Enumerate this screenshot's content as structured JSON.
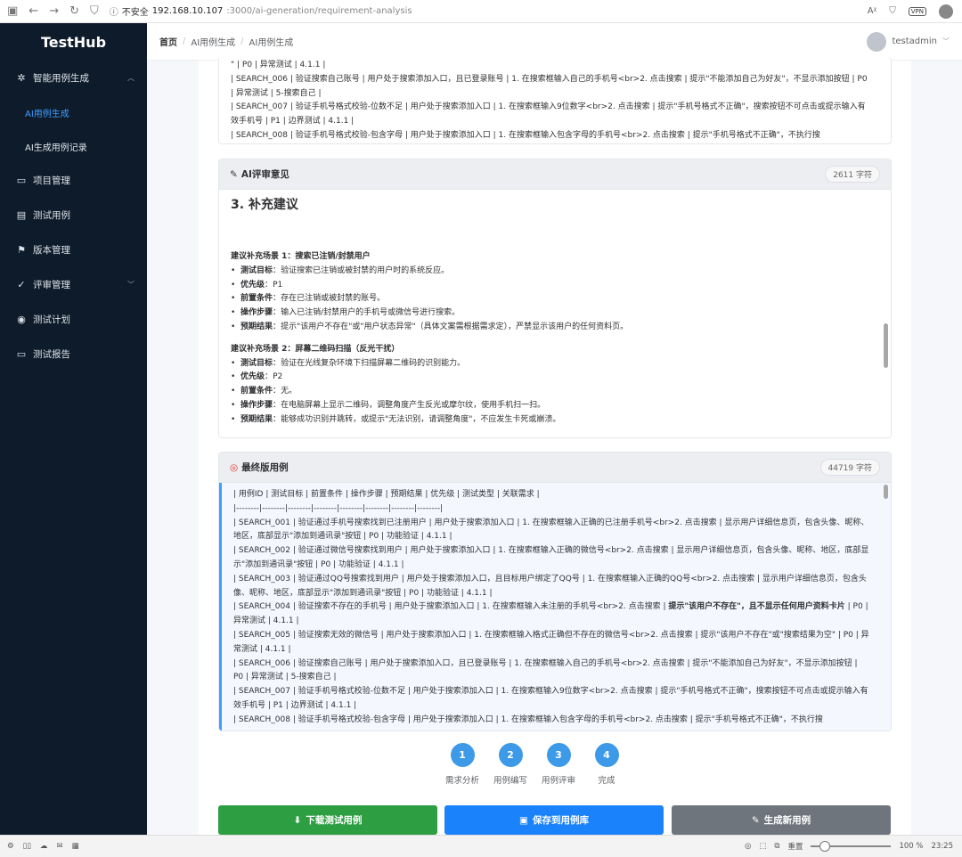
{
  "browser": {
    "insecure_label": "不安全",
    "url_host": "192.168.10.107",
    "url_path": ":3000/ai-generation/requirement-analysis",
    "vpn_label": "VPN"
  },
  "sidebar": {
    "brand": "TestHub",
    "items": [
      {
        "label": "智能用例生成",
        "icon": "sparkle-icon",
        "expanded": true
      },
      {
        "label": "项目管理",
        "icon": "folder-icon"
      },
      {
        "label": "测试用例",
        "icon": "document-icon"
      },
      {
        "label": "版本管理",
        "icon": "flag-icon"
      },
      {
        "label": "评审管理",
        "icon": "check-icon"
      },
      {
        "label": "测试计划",
        "icon": "play-circle-icon"
      },
      {
        "label": "测试报告",
        "icon": "report-icon"
      }
    ],
    "sub_items": [
      {
        "label": "AI用例生成",
        "active": true
      },
      {
        "label": "AI生成用例记录",
        "active": false
      }
    ]
  },
  "header": {
    "breadcrumb": [
      "首页",
      "AI用例生成",
      "AI用例生成"
    ],
    "username": "testadmin"
  },
  "top_card": {
    "lines": [
      "\" | P0 | 异常测试 | 4.1.1 |",
      "| SEARCH_006 | 验证搜索自己账号 | 用户处于搜索添加入口，且已登录账号 | 1. 在搜索框输入自己的手机号<br>2. 点击搜索 | 提示\"不能添加自己为好友\"，不显示添加按钮 | P0 | 异常测试 | 5-搜索自己 |",
      "| SEARCH_007 | 验证手机号格式校验-位数不足 | 用户处于搜索添加入口 | 1. 在搜索框输入9位数字<br>2. 点击搜索 | 提示\"手机号格式不正确\"，搜索按钮不可点击或提示输入有效手机号 | P1 | 边界测试 | 4.1.1 |",
      "| SEARCH_008 | 验证手机号格式校验-包含字母 | 用户处于搜索添加入口 | 1. 在搜索框输入包含字母的手机号<br>2. 点击搜索 | 提示\"手机号格式不正确\"，不执行搜"
    ]
  },
  "review_card": {
    "title": "AI评审意见",
    "count": "2611 字符",
    "heading": "3. 补充建议",
    "scenarios": [
      {
        "title": "建议补充场景 1：搜索已注销/封禁用户",
        "items": [
          {
            "k": "测试目标",
            "v": "验证搜索已注销或被封禁的用户时的系统反应。"
          },
          {
            "k": "优先级",
            "v": "P1"
          },
          {
            "k": "前置条件",
            "v": "存在已注销或被封禁的账号。"
          },
          {
            "k": "操作步骤",
            "v": "输入已注销/封禁用户的手机号或微信号进行搜索。"
          },
          {
            "k": "预期结果",
            "v": "提示\"该用户不存在\"或\"用户状态异常\"（具体文案需根据需求定），严禁显示该用户的任何资料页。"
          }
        ]
      },
      {
        "title": "建议补充场景 2：屏幕二维码扫描（反光干扰）",
        "items": [
          {
            "k": "测试目标",
            "v": "验证在光线复杂环境下扫描屏幕二维码的识别能力。"
          },
          {
            "k": "优先级",
            "v": "P2"
          },
          {
            "k": "前置条件",
            "v": "无。"
          },
          {
            "k": "操作步骤",
            "v": "在电脑屏幕上显示二维码，调整角度产生反光或摩尔纹，使用手机扫一扫。"
          },
          {
            "k": "预期结果",
            "v": "能够成功识别并跳转，或提示\"无法识别，请调整角度\"，不应发生卡死或崩溃。"
          }
        ]
      }
    ]
  },
  "final_card": {
    "title": "最终版用例",
    "count": "44719 字符",
    "lines": [
      "| 用例ID | 测试目标 | 前置条件 | 操作步骤 | 预期结果 | 优先级 | 测试类型 | 关联需求 |",
      "|--------|--------|--------|--------|--------|--------|--------|--------|",
      "| SEARCH_001 | 验证通过手机号搜索找到已注册用户 | 用户处于搜索添加入口 | 1. 在搜索框输入正确的已注册手机号<br>2. 点击搜索 | 显示用户详细信息页，包含头像、昵称、地区，底部显示\"添加到通讯录\"按钮 | P0 | 功能验证 | 4.1.1 |",
      "| SEARCH_002 | 验证通过微信号搜索找到用户 | 用户处于搜索添加入口 | 1. 在搜索框输入正确的微信号<br>2. 点击搜索 | 显示用户详细信息页，包含头像、昵称、地区，底部显示\"添加到通讯录\"按钮 | P0 | 功能验证 | 4.1.1 |",
      "| SEARCH_003 | 验证通过QQ号搜索找到用户 | 用户处于搜索添加入口，且目标用户绑定了QQ号 | 1. 在搜索框输入正确的QQ号<br>2. 点击搜索 | 显示用户详细信息页，包含头像、昵称、地区，底部显示\"添加到通讯录\"按钮 | P0 | 功能验证 | 4.1.1 |"
    ],
    "line_004_prefix": "| SEARCH_004 | 验证搜索不存在的手机号 | 用户处于搜索添加入口 | 1. 在搜索框输入未注册的手机号<br>2. 点击搜索 | ",
    "line_004_bold": "提示\"该用户不存在\"，且不显示任何用户资料卡片",
    "line_004_suffix": " | P0 | 异常测试 | 4.1.1 |",
    "lines_after": [
      "| SEARCH_005 | 验证搜索无效的微信号 | 用户处于搜索添加入口 | 1. 在搜索框输入格式正确但不存在的微信号<br>2. 点击搜索 | 提示\"该用户不存在\"或\"搜索结果为空\" | P0 | 异常测试 | 4.1.1 |",
      "| SEARCH_006 | 验证搜索自己账号 | 用户处于搜索添加入口，且已登录账号 | 1. 在搜索框输入自己的手机号<br>2. 点击搜索 | 提示\"不能添加自己为好友\"，不显示添加按钮 | P0 | 异常测试 | 5-搜索自己 |",
      "| SEARCH_007 | 验证手机号格式校验-位数不足 | 用户处于搜索添加入口 | 1. 在搜索框输入9位数字<br>2. 点击搜索 | 提示\"手机号格式不正确\"，搜索按钮不可点击或提示输入有效手机号 | P1 | 边界测试 | 4.1.1 |",
      "| SEARCH_008 | 验证手机号格式校验-包含字母 | 用户处于搜索添加入口 | 1. 在搜索框输入包含字母的手机号<br>2. 点击搜索 | 提示\"手机号格式不正确\"，不执行搜"
    ]
  },
  "steps": [
    {
      "num": "1",
      "label": "需求分析"
    },
    {
      "num": "2",
      "label": "用例编写"
    },
    {
      "num": "3",
      "label": "用例评审"
    },
    {
      "num": "4",
      "label": "完成"
    }
  ],
  "actions": {
    "download": "下载测试用例",
    "save": "保存到用例库",
    "regenerate": "生成新用例"
  },
  "statusbar": {
    "reset_label": "重置",
    "zoom": "100 %",
    "time": "23:25"
  },
  "colors": {
    "sidebar_bg": "#0d1b2a",
    "accent": "#409eff",
    "download_btn": "#2e9e43",
    "save_btn": "#1a83fb",
    "regen_btn": "#6f757c",
    "step_circle": "#3d9ae8"
  }
}
